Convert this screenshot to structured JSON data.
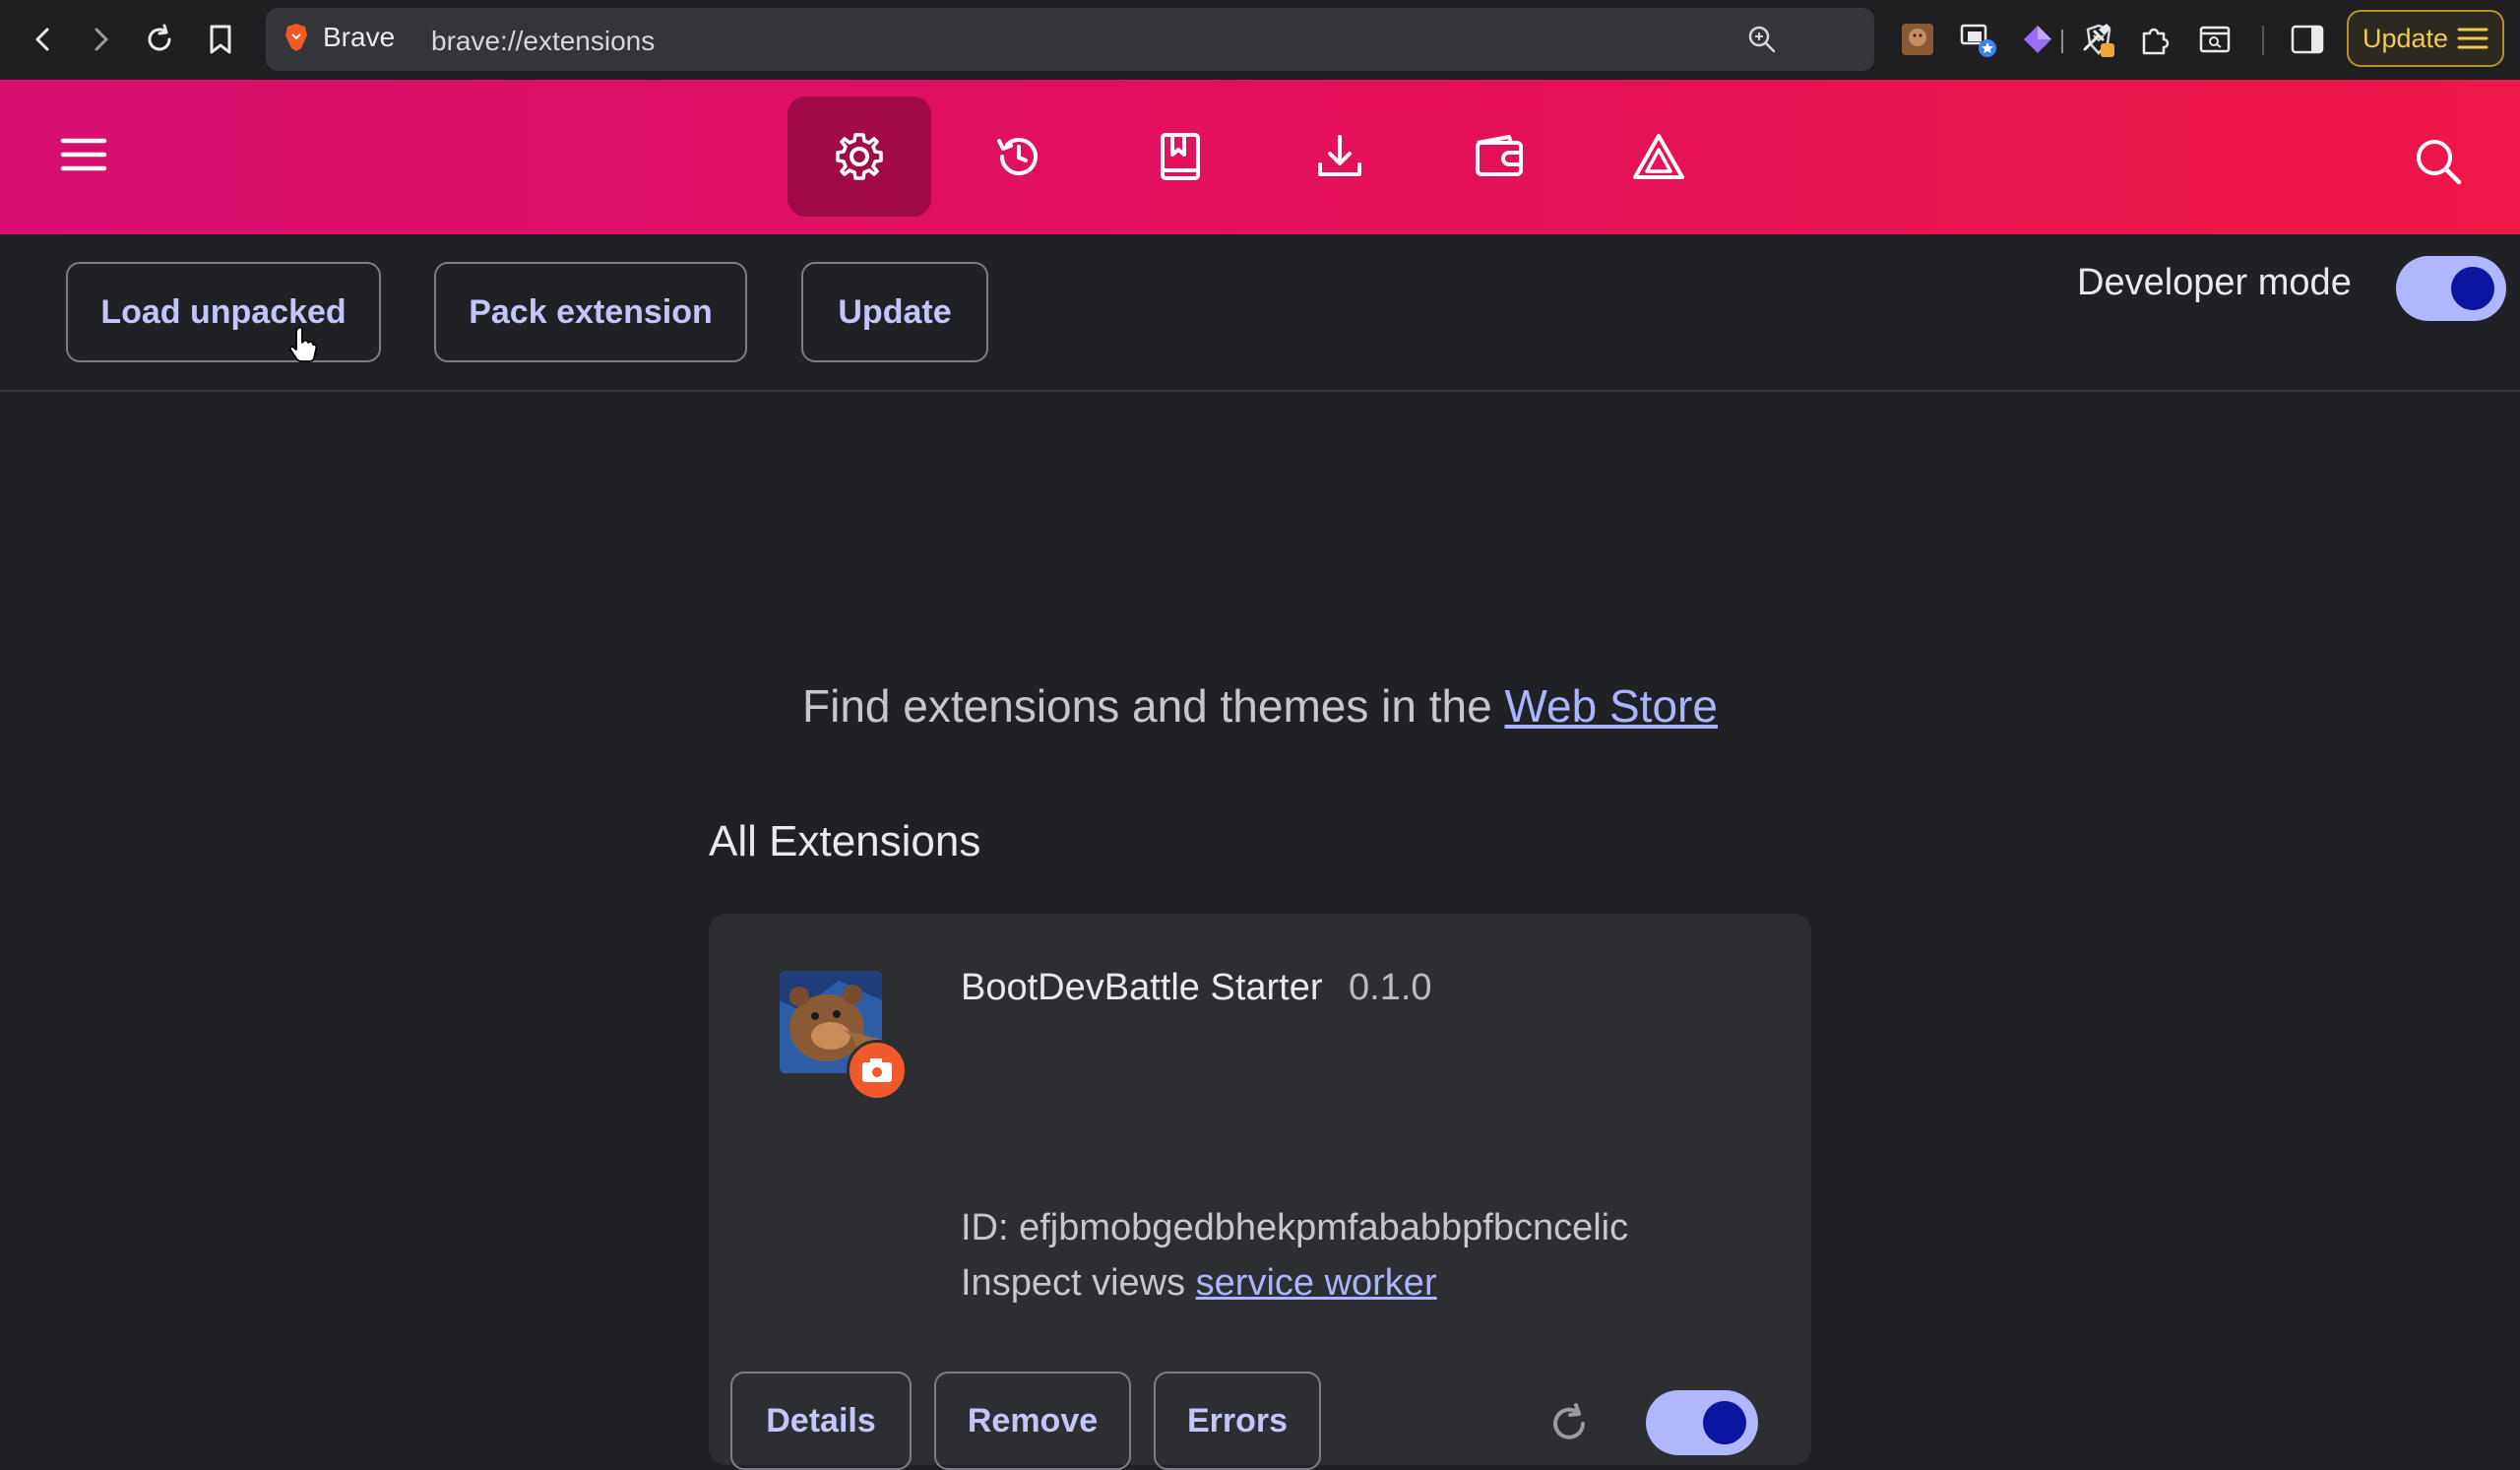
{
  "browser": {
    "brand_label": "Brave",
    "url": "brave://extensions",
    "update_label": "Update"
  },
  "toolbar": {
    "tabs": [
      {
        "name": "settings",
        "icon": "gear-icon",
        "active": true
      },
      {
        "name": "history",
        "icon": "history-icon",
        "active": false
      },
      {
        "name": "bookmarks",
        "icon": "bookmarks-icon",
        "active": false
      },
      {
        "name": "downloads",
        "icon": "download-icon",
        "active": false
      },
      {
        "name": "wallet",
        "icon": "wallet-icon",
        "active": false
      },
      {
        "name": "rewards",
        "icon": "rewards-icon",
        "active": false
      }
    ],
    "accent_color": "#e4105a"
  },
  "dev": {
    "load_unpacked": "Load unpacked",
    "pack_extension": "Pack extension",
    "update": "Update",
    "developer_mode_label": "Developer mode",
    "developer_mode_on": true
  },
  "main": {
    "store_prefix": "Find extensions and themes in the ",
    "store_link": "Web Store",
    "section_title": "All Extensions"
  },
  "extension": {
    "name": "BootDevBattle Starter",
    "version": "0.1.0",
    "id_line": "ID: efjbmobgedbhekpmfababbpfbcncelic",
    "inspect_prefix": "Inspect views ",
    "inspect_link": "service worker",
    "details_label": "Details",
    "remove_label": "Remove",
    "errors_label": "Errors",
    "enabled": true
  }
}
